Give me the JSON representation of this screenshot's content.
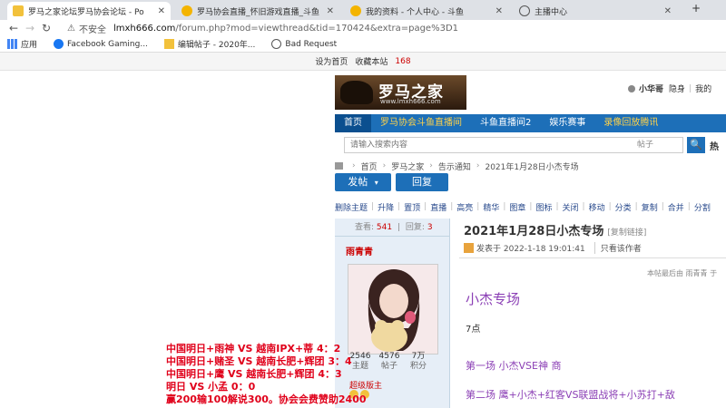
{
  "browser": {
    "tabs": [
      {
        "label": "罗马之家论坛罗马协会论坛 - Po",
        "active": true
      },
      {
        "label": "罗马协会直播_怀旧游戏直播_斗鱼",
        "active": false
      },
      {
        "label": "我的资料 - 个人中心 - 斗鱼",
        "active": false
      },
      {
        "label": "主播中心",
        "active": false
      }
    ],
    "new_tab": "+",
    "win_min": "–",
    "url_warn": "⚠",
    "url_insecure": "不安全",
    "url_host": "lmxh666.com",
    "url_rest": "/forum.php?mod=viewthread&tid=170424&extra=page%3D1",
    "bookmarks": [
      "应用",
      "Facebook Gaming...",
      "编辑帖子 - 2020年...",
      "Bad Request"
    ]
  },
  "site": {
    "topbar": {
      "set_home": "设为首页",
      "bookmark": "收藏本站",
      "count": "168"
    },
    "logo_main": "罗马之家",
    "logo_sub": "www.lmxh666.com",
    "user": {
      "name": "小华哥",
      "hide": "隐身",
      "mine": "我的"
    },
    "nav": [
      "首页",
      "罗马协会斗鱼直播间",
      "斗鱼直播间2",
      "娱乐赛事",
      "录像回放腾讯"
    ],
    "search_placeholder": "请输入搜索内容",
    "search_cat": "帖子",
    "search_icon": "🔍",
    "hot": "热",
    "breadcrumb": [
      "首页",
      "罗马之家",
      "告示通知",
      "2021年1月28日小杰专场"
    ],
    "btn_post": "发帖",
    "btn_reply": "回复",
    "modbar": [
      "删除主题",
      "升降",
      "置顶",
      "直播",
      "高亮",
      "精华",
      "图章",
      "图标",
      "关闭",
      "移动",
      "分类",
      "复制",
      "合并",
      "分割"
    ]
  },
  "post": {
    "views_label": "查看:",
    "views": "541",
    "replies_label": "回复:",
    "replies": "3",
    "author": "雨青青",
    "user_stats": [
      {
        "value": "2546",
        "label": "主题"
      },
      {
        "value": "4576",
        "label": "帖子"
      },
      {
        "value": "7万",
        "label": "积分"
      }
    ],
    "user_title": "超级版主",
    "title": "2021年1月28日小杰专场",
    "title_ext": "[复制链接]",
    "published": "发表于 2022-1-18 19:01:41",
    "view_author": "只看该作者",
    "last_edit": "本帖最后由 雨青青 于",
    "heading": "小杰专场",
    "para": "7点",
    "line1": "第一场   小杰VSE神   商",
    "line2": "第二场   鹰+小杰+红客VS联盟战将+小苏打+敌"
  },
  "overlay_lines": [
    "中国明日+雨神  VS 越南IPX+蒂   4：2",
    "中国明日+赌圣  VS  越南长肥+辉团  3：4",
    "中国明日+鹰 VS 越南长肥+辉团  4：3",
    "明日  VS  小孟  0：0",
    "赢200输100解说300。协会会费赞助2400"
  ]
}
